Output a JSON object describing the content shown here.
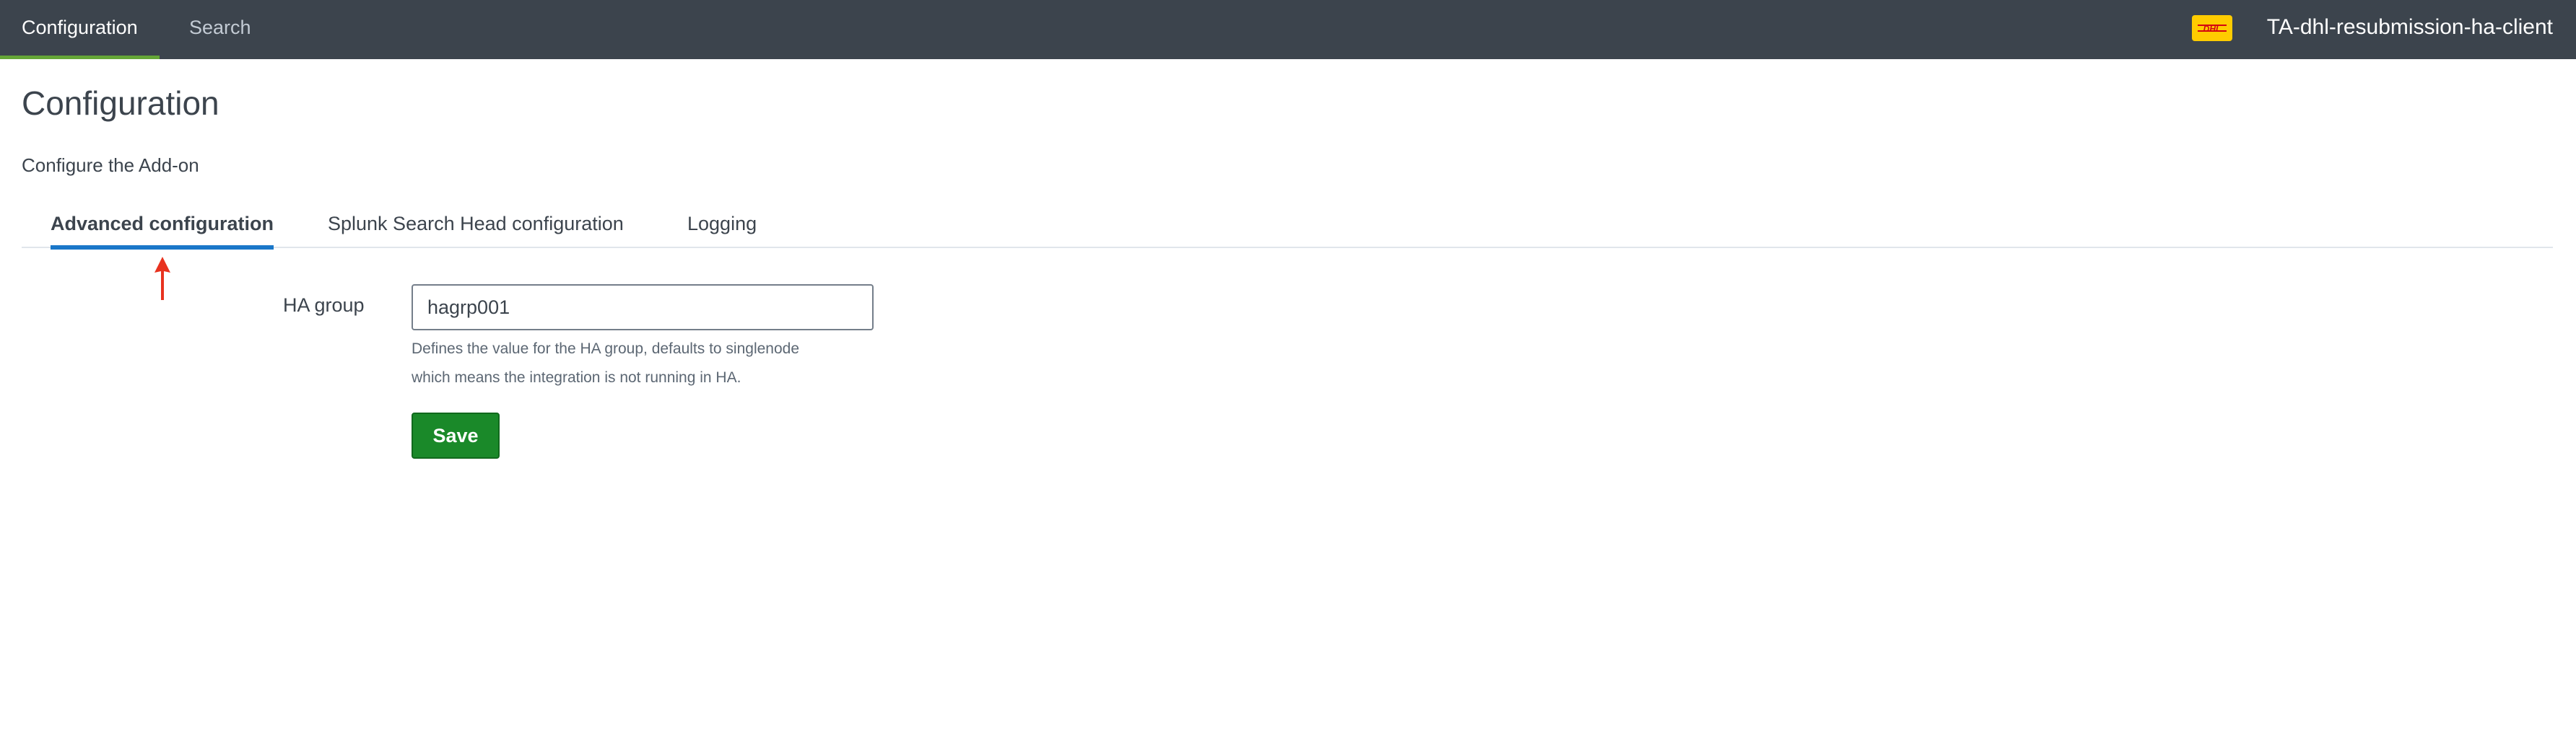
{
  "nav": {
    "items": [
      {
        "label": "Configuration",
        "active": true
      },
      {
        "label": "Search",
        "active": false
      }
    ],
    "app_name": "TA-dhl-resubmission-ha-client",
    "logo_icon": "dhl-logo",
    "logo_text": "DHL"
  },
  "page": {
    "title": "Configuration",
    "subtitle": "Configure the Add-on"
  },
  "tabs": [
    {
      "label": "Advanced configuration",
      "active": true
    },
    {
      "label": "Splunk Search Head configuration",
      "active": false
    },
    {
      "label": "Logging",
      "active": false
    }
  ],
  "form": {
    "ha_group": {
      "label": "HA group",
      "value": "hagrp001",
      "help_line1": "Defines the value for the HA group, defaults to singlenode",
      "help_line2": "which means the integration is not running in HA."
    },
    "save_label": "Save"
  },
  "colors": {
    "topbar": "#3c444d",
    "nav_active_underline": "#65a637",
    "tab_active_underline": "#1a77c9",
    "save_button": "#1a8929",
    "annotation_arrow": "#e8321f",
    "logo_bg": "#ffcc00",
    "logo_fg": "#d40511"
  }
}
